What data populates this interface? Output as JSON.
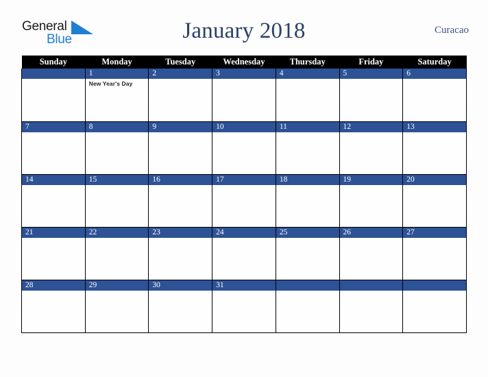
{
  "brand": {
    "name_line1": "General",
    "name_line2": "Blue",
    "triangle_color": "#1f7fd4",
    "text_color": "#1b1b1b"
  },
  "header": {
    "title": "January 2018",
    "locale": "Curacao",
    "title_color": "#2b3f68",
    "locale_color": "#3c5383"
  },
  "calendar": {
    "month": "January",
    "year": "2018",
    "header_bg": "#000000",
    "header_text_color": "#ffffff",
    "daynum_band_color": "#2e5296",
    "daynum_text_color": "#ffffff",
    "grid_line_color": "#000000",
    "cell_bg": "#fefefe",
    "weekday_headers": [
      "Sunday",
      "Monday",
      "Tuesday",
      "Wednesday",
      "Thursday",
      "Friday",
      "Saturday"
    ],
    "weeks": [
      [
        {
          "day": "",
          "events": []
        },
        {
          "day": "1",
          "events": [
            "New Year's Day"
          ]
        },
        {
          "day": "2",
          "events": []
        },
        {
          "day": "3",
          "events": []
        },
        {
          "day": "4",
          "events": []
        },
        {
          "day": "5",
          "events": []
        },
        {
          "day": "6",
          "events": []
        }
      ],
      [
        {
          "day": "7",
          "events": []
        },
        {
          "day": "8",
          "events": []
        },
        {
          "day": "9",
          "events": []
        },
        {
          "day": "10",
          "events": []
        },
        {
          "day": "11",
          "events": []
        },
        {
          "day": "12",
          "events": []
        },
        {
          "day": "13",
          "events": []
        }
      ],
      [
        {
          "day": "14",
          "events": []
        },
        {
          "day": "15",
          "events": []
        },
        {
          "day": "16",
          "events": []
        },
        {
          "day": "17",
          "events": []
        },
        {
          "day": "18",
          "events": []
        },
        {
          "day": "19",
          "events": []
        },
        {
          "day": "20",
          "events": []
        }
      ],
      [
        {
          "day": "21",
          "events": []
        },
        {
          "day": "22",
          "events": []
        },
        {
          "day": "23",
          "events": []
        },
        {
          "day": "24",
          "events": []
        },
        {
          "day": "25",
          "events": []
        },
        {
          "day": "26",
          "events": []
        },
        {
          "day": "27",
          "events": []
        }
      ],
      [
        {
          "day": "28",
          "events": []
        },
        {
          "day": "29",
          "events": []
        },
        {
          "day": "30",
          "events": []
        },
        {
          "day": "31",
          "events": []
        },
        {
          "day": "",
          "events": []
        },
        {
          "day": "",
          "events": []
        },
        {
          "day": "",
          "events": []
        }
      ]
    ]
  }
}
